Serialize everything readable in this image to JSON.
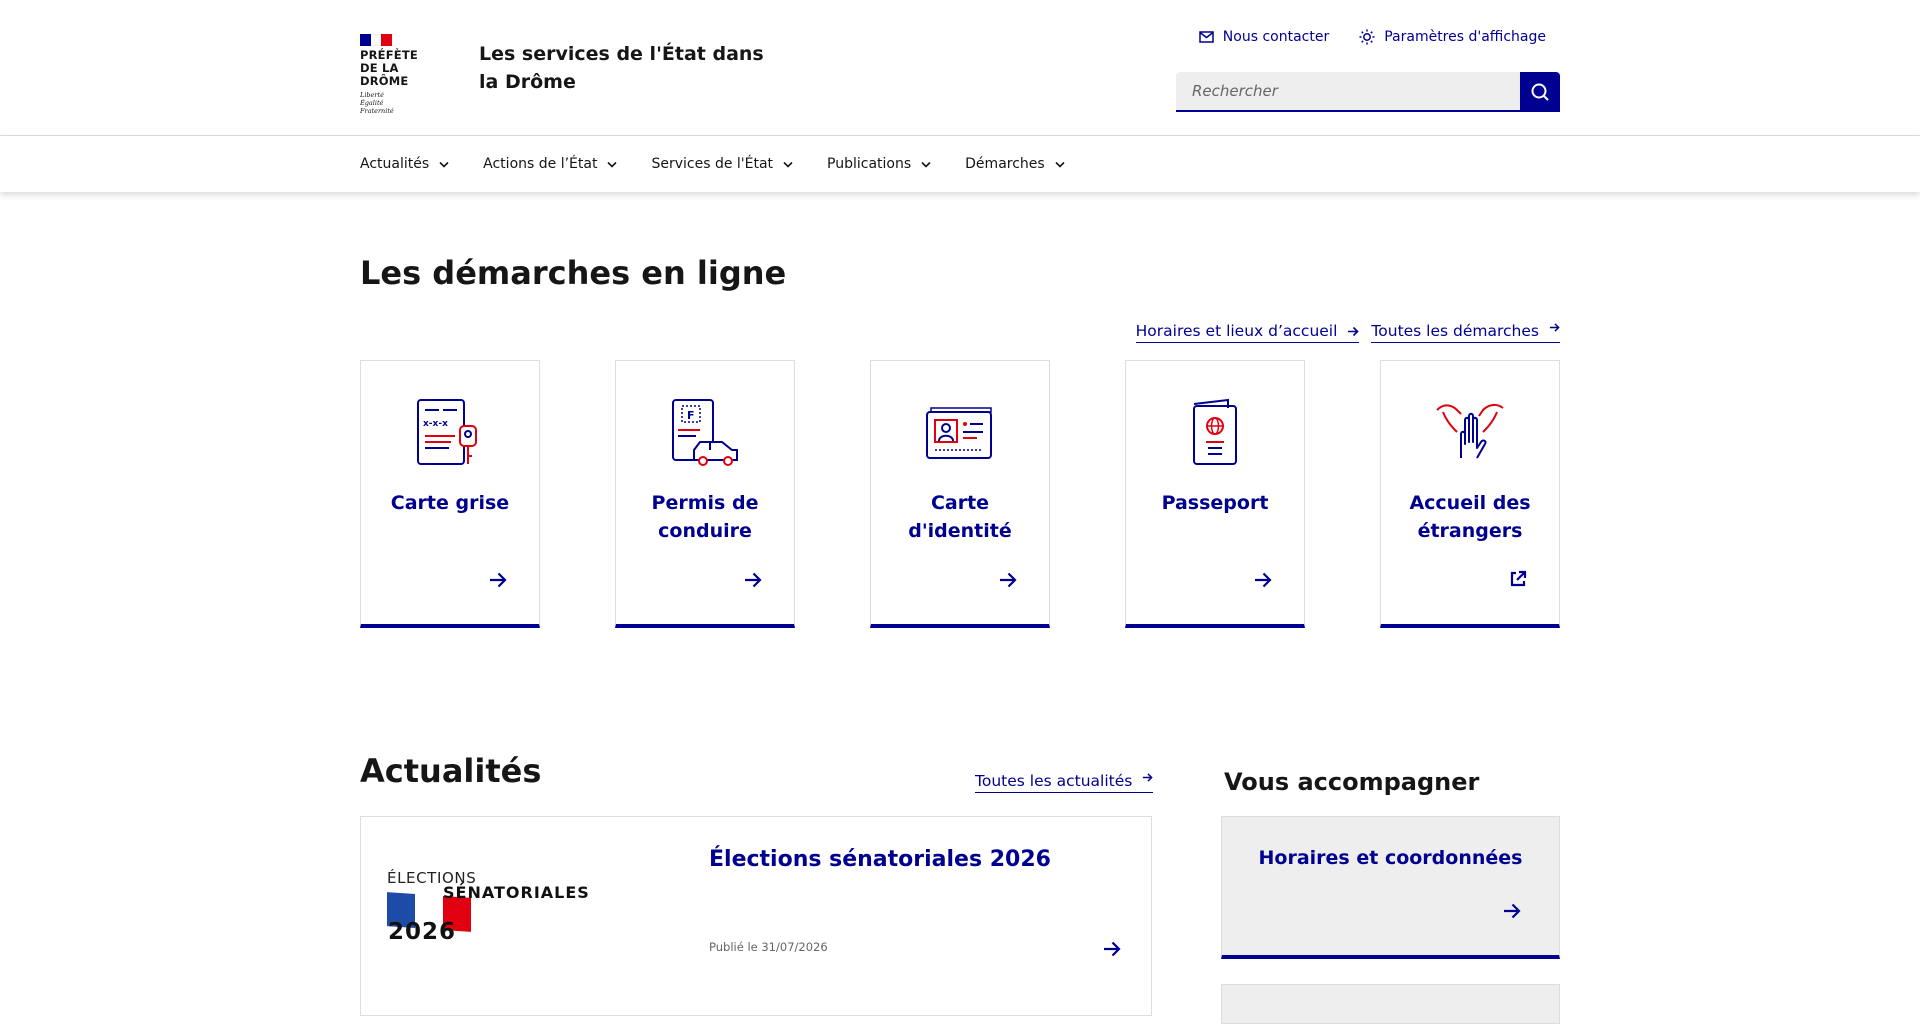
{
  "header": {
    "logo": {
      "name_line1": "PRÉFÈTE",
      "name_line2": "DE LA DRÔME",
      "motto_line1": "Liberté",
      "motto_line2": "Égalité",
      "motto_line3": "Fraternité",
      "flag_colors": [
        "#000091",
        "#ffffff",
        "#e1000f"
      ]
    },
    "service_title": "Les services de l'État dans la Drôme",
    "contact_label": "Nous contacter",
    "display_settings_label": "Paramètres d'affichage",
    "search_placeholder": "Rechercher"
  },
  "nav": {
    "items": [
      {
        "label": "Actualités"
      },
      {
        "label": "Actions de l’État"
      },
      {
        "label": "Services de l'État"
      },
      {
        "label": "Publications"
      },
      {
        "label": "Démarches"
      }
    ]
  },
  "demarches": {
    "title": "Les démarches en ligne",
    "link_horaires": "Horaires et lieux d’accueil",
    "link_toutes": "Toutes les démarches",
    "cards": [
      {
        "title": "Carte grise",
        "icon": "vehicle-registration-icon",
        "link": "arrow-right-icon"
      },
      {
        "title": "Permis de conduire",
        "icon": "driving-license-icon",
        "link": "arrow-right-icon"
      },
      {
        "title": "Carte d'identité",
        "icon": "id-card-icon",
        "link": "arrow-right-icon"
      },
      {
        "title": "Passeport",
        "icon": "passport-icon",
        "link": "arrow-right-icon"
      },
      {
        "title": "Accueil des étrangers",
        "icon": "foreigners-welcome-icon",
        "link": "external-link-icon"
      }
    ]
  },
  "actualites": {
    "title": "Actualités",
    "link_toutes": "Toutes les actualités",
    "news": {
      "title": "Élections sénatoriales 2026",
      "date": "Publié le 31/07/2026",
      "image_text_1": "ÉLECTIONS",
      "image_text_2": "SÉNATORIALES",
      "image_text_3": "2026"
    }
  },
  "accompagner": {
    "title": "Vous accompagner",
    "card_title": "Horaires et coordonnées"
  },
  "colors": {
    "primary": "#000091",
    "accent_red": "#e1000f",
    "grey_bg": "#eeeeee",
    "border": "#dddddd"
  }
}
